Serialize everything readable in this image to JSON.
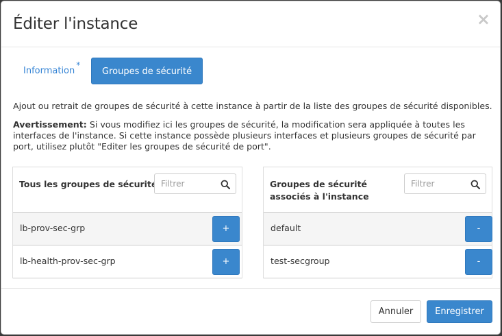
{
  "modal": {
    "title": "Éditer l'instance",
    "close_symbol": "×"
  },
  "tabs": [
    {
      "label": "Information",
      "required_marker": "*",
      "active": false
    },
    {
      "label": "Groupes de sécurité",
      "active": true
    }
  ],
  "description": {
    "line1": "Ajout ou retrait de groupes de sécurité à cette instance à partir de la liste des groupes de sécurité disponibles.",
    "warning_label": "Avertissement:",
    "warning_text": " Si vous modifiez ici les groupes de sécurité, la modification sera appliquée à toutes les interfaces de l'instance. Si cette instance possède plusieurs interfaces et plusieurs groupes de sécurité par port, utilisez plutôt \"Editer les groupes de sécurité de port\"."
  },
  "available_panel": {
    "title": "Tous les groupes de sécurité",
    "filter_placeholder": "Filtrer",
    "add_label": "+",
    "items": [
      {
        "name": "lb-prov-sec-grp"
      },
      {
        "name": "lb-health-prov-sec-grp"
      }
    ]
  },
  "assigned_panel": {
    "title": "Groupes de sécurité associés à l'instance",
    "filter_placeholder": "Filtrer",
    "remove_label": "-",
    "items": [
      {
        "name": "default"
      },
      {
        "name": "test-secgroup"
      }
    ]
  },
  "footer": {
    "cancel_label": "Annuler",
    "save_label": "Enregistrer"
  },
  "icons": {
    "filter_icon": "search-icon",
    "close_icon": "close-icon"
  },
  "colors": {
    "primary": "#3a87cd",
    "link": "#3584d5"
  }
}
